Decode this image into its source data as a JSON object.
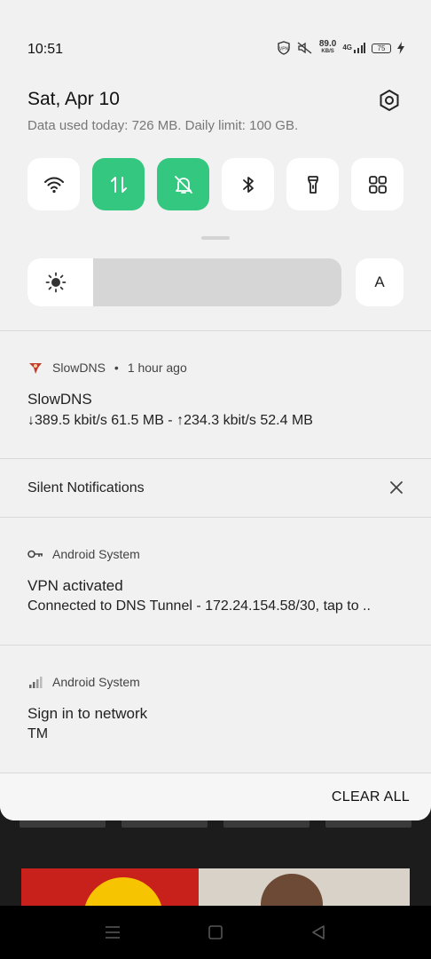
{
  "status_bar": {
    "time": "10:51",
    "vpn_label": "VPN",
    "speed_value": "89.0",
    "speed_unit": "KB/S",
    "network": "4G",
    "battery": "75"
  },
  "header": {
    "date": "Sat, Apr 10",
    "data_usage": "Data used today: 726 MB. Daily limit: 100 GB."
  },
  "quick_tiles": [
    {
      "icon": "wifi-icon",
      "active": false
    },
    {
      "icon": "mobile-data-icon",
      "active": true
    },
    {
      "icon": "silent-mode-icon",
      "active": true
    },
    {
      "icon": "bluetooth-icon",
      "active": false
    },
    {
      "icon": "flashlight-icon",
      "active": false
    },
    {
      "icon": "more-tiles-icon",
      "active": false
    }
  ],
  "brightness": {
    "level": 0.21,
    "auto_label": "A"
  },
  "notifications": {
    "slowdns": {
      "app": "SlowDNS",
      "time": "1 hour ago",
      "title": "SlowDNS",
      "text": "↓389.5 kbit/s 61.5 MB - ↑234.3 kbit/s 52.4 MB"
    },
    "silent_header": "Silent Notifications",
    "vpn": {
      "app": "Android System",
      "title": "VPN activated",
      "text": "Connected to DNS Tunnel - 172.24.154.58/30, tap to .."
    },
    "network": {
      "app": "Android System",
      "title": "Sign in to network",
      "text": "TM"
    }
  },
  "footer": {
    "clear_all": "CLEAR ALL"
  },
  "colors": {
    "accent_green": "#34c77f",
    "panel_bg": "#f1f1f1"
  }
}
